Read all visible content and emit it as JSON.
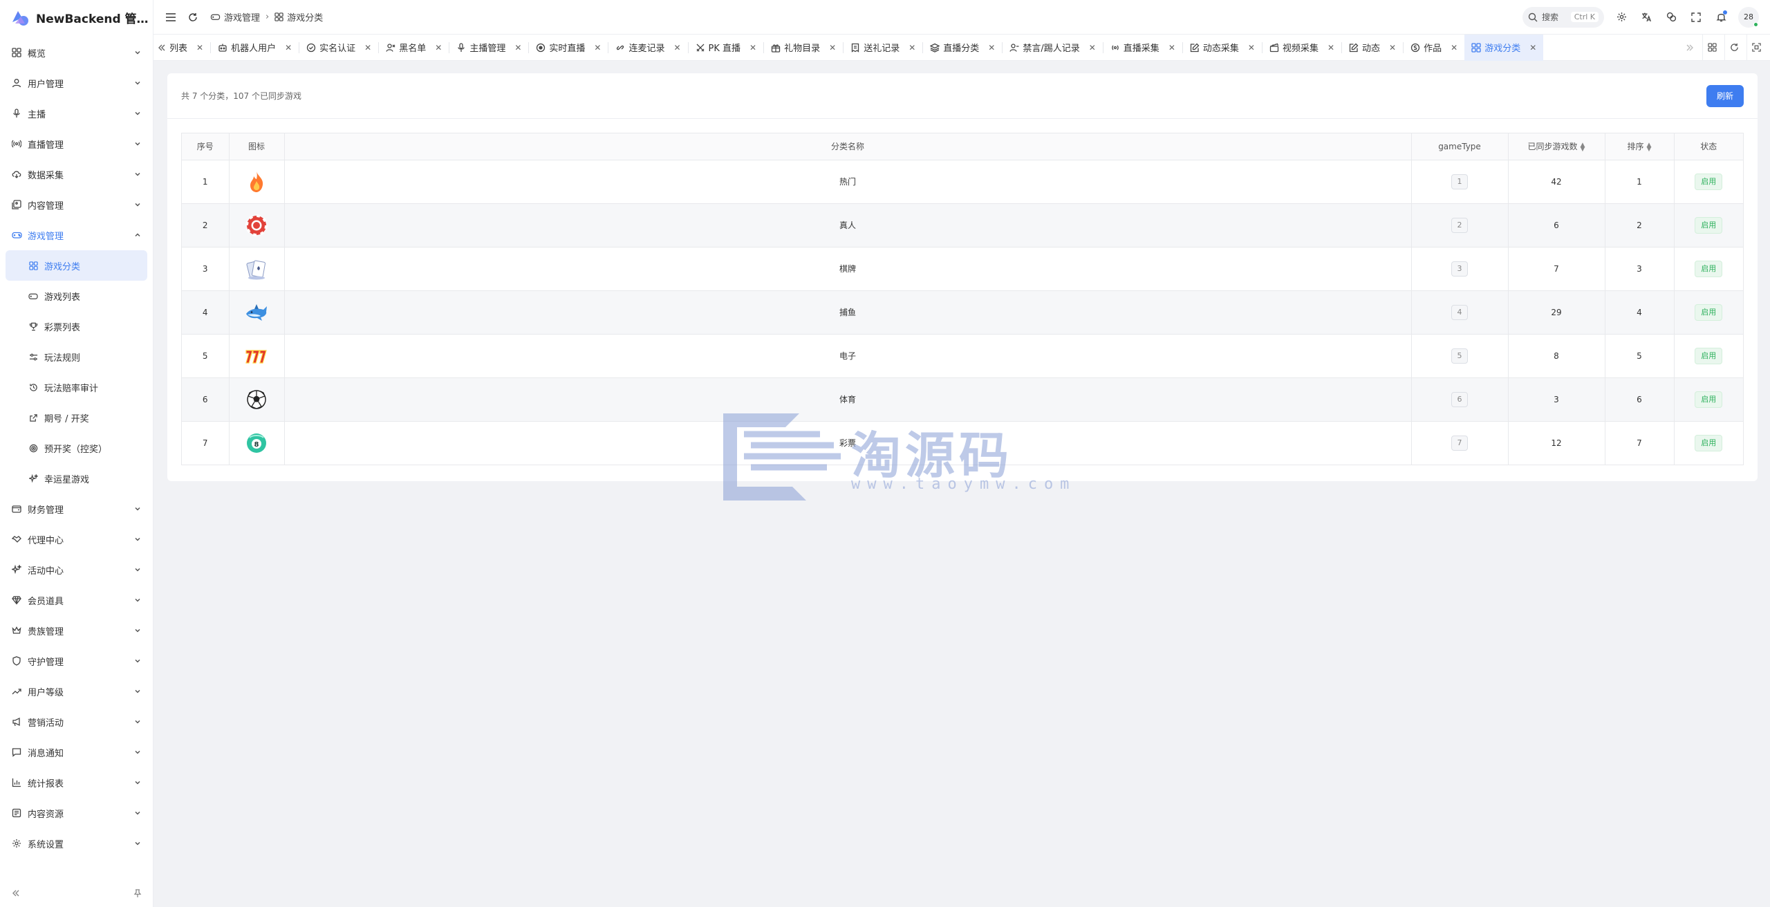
{
  "app": {
    "title": "NewBackend 管理系统"
  },
  "header": {
    "breadcrumb": [
      "游戏管理",
      "游戏分类"
    ],
    "search_placeholder": "搜索",
    "search_shortcut": "Ctrl K",
    "avatar_text": "28"
  },
  "sidebar": {
    "items": [
      {
        "label": "概览",
        "icon": "grid-icon"
      },
      {
        "label": "用户管理",
        "icon": "user-icon"
      },
      {
        "label": "主播",
        "icon": "mic-icon"
      },
      {
        "label": "直播管理",
        "icon": "broadcast-icon"
      },
      {
        "label": "数据采集",
        "icon": "cloud-download-icon"
      },
      {
        "label": "内容管理",
        "icon": "content-icon"
      },
      {
        "label": "游戏管理",
        "icon": "gamepad-icon"
      },
      {
        "label": "财务管理",
        "icon": "wallet-icon"
      },
      {
        "label": "代理中心",
        "icon": "handshake-icon"
      },
      {
        "label": "活动中心",
        "icon": "sparkle-icon"
      },
      {
        "label": "会员道具",
        "icon": "gem-icon"
      },
      {
        "label": "贵族管理",
        "icon": "crown-icon"
      },
      {
        "label": "守护管理",
        "icon": "shield-icon"
      },
      {
        "label": "用户等级",
        "icon": "trend-up-icon"
      },
      {
        "label": "营销活动",
        "icon": "megaphone-icon"
      },
      {
        "label": "消息通知",
        "icon": "message-icon"
      },
      {
        "label": "统计报表",
        "icon": "bar-chart-icon"
      },
      {
        "label": "内容资源",
        "icon": "library-icon"
      },
      {
        "label": "系统设置",
        "icon": "gear-icon"
      }
    ],
    "game_submenu": [
      {
        "label": "游戏分类",
        "icon": "grid-icon"
      },
      {
        "label": "游戏列表",
        "icon": "gamepad-icon"
      },
      {
        "label": "彩票列表",
        "icon": "trophy-icon"
      },
      {
        "label": "玩法规则",
        "icon": "sliders-icon"
      },
      {
        "label": "玩法赔率审计",
        "icon": "history-icon"
      },
      {
        "label": "期号 / 开奖",
        "icon": "share-icon"
      },
      {
        "label": "预开奖（控奖）",
        "icon": "target-icon"
      },
      {
        "label": "幸运星游戏",
        "icon": "sparkle-icon"
      }
    ]
  },
  "tabs": [
    {
      "label": "户列表",
      "icon": ""
    },
    {
      "label": "机器人用户",
      "icon": "robot-icon"
    },
    {
      "label": "实名认证",
      "icon": "badge-icon"
    },
    {
      "label": "黑名单",
      "icon": "user-x-icon"
    },
    {
      "label": "主播管理",
      "icon": "mic-icon"
    },
    {
      "label": "实时直播",
      "icon": "record-icon"
    },
    {
      "label": "连麦记录",
      "icon": "link-icon"
    },
    {
      "label": "PK 直播",
      "icon": "swords-icon"
    },
    {
      "label": "礼物目录",
      "icon": "gift-icon"
    },
    {
      "label": "送礼记录",
      "icon": "receipt-icon"
    },
    {
      "label": "直播分类",
      "icon": "layers-icon"
    },
    {
      "label": "禁言/踢人记录",
      "icon": "user-minus-icon"
    },
    {
      "label": "直播采集",
      "icon": "broadcast-icon"
    },
    {
      "label": "动态采集",
      "icon": "edit-icon"
    },
    {
      "label": "视频采集",
      "icon": "clapper-icon"
    },
    {
      "label": "动态",
      "icon": "edit-icon"
    },
    {
      "label": "作品",
      "icon": "coin-icon"
    },
    {
      "label": "游戏分类",
      "icon": "grid-icon",
      "active": true
    }
  ],
  "page": {
    "summary": "共 7 个分类，107 个已同步游戏",
    "refresh_label": "刷新",
    "columns": [
      "序号",
      "图标",
      "分类名称",
      "gameType",
      "已同步游戏数",
      "排序",
      "状态"
    ],
    "rows": [
      {
        "index": "1",
        "icon": "fire-icon",
        "name": "热门",
        "gameType": "1",
        "synced": "42",
        "sort": "1",
        "status": "启用"
      },
      {
        "index": "2",
        "icon": "casino-chip-icon",
        "name": "真人",
        "gameType": "2",
        "synced": "6",
        "sort": "2",
        "status": "启用"
      },
      {
        "index": "3",
        "icon": "playing-cards-icon",
        "name": "棋牌",
        "gameType": "3",
        "synced": "7",
        "sort": "3",
        "status": "启用"
      },
      {
        "index": "4",
        "icon": "shark-icon",
        "name": "捕鱼",
        "gameType": "4",
        "synced": "29",
        "sort": "4",
        "status": "启用"
      },
      {
        "index": "5",
        "icon": "slot-777-icon",
        "name": "电子",
        "gameType": "5",
        "synced": "8",
        "sort": "5",
        "status": "启用"
      },
      {
        "index": "6",
        "icon": "soccer-ball-icon",
        "name": "体育",
        "gameType": "6",
        "synced": "3",
        "sort": "6",
        "status": "启用"
      },
      {
        "index": "7",
        "icon": "lottery-ball-icon",
        "name": "彩票",
        "gameType": "7",
        "synced": "12",
        "sort": "7",
        "status": "启用"
      }
    ]
  },
  "watermark": {
    "text": "淘源码",
    "url": "www.taoymw.com"
  },
  "colors": {
    "accent": "#3e7df0",
    "success": "#2fb15d",
    "active_bg": "#e8eefc"
  }
}
